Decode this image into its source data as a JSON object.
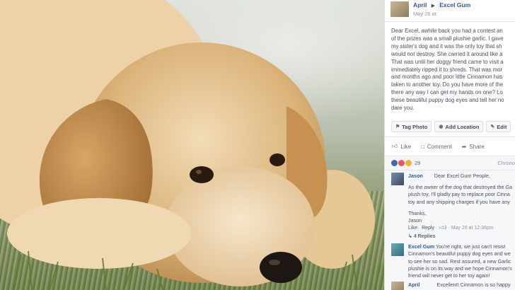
{
  "post": {
    "author": "April",
    "target": "Excel Gum",
    "date": "May 26 at",
    "body_lines": [
      "Dear Excel, awhile back you had a contest an",
      "of the prizes was a small plushie garlic. I gave",
      "my sister's dog and it was the only toy that sh",
      "would not destroy. She carried it around like a",
      "That was until her doggy friend came to visit a",
      "immediately ripped it to shreds. That was mor",
      "and months ago and poor little Cinnamon has",
      "taken to another toy. Do you have more of the",
      "there any way I can get my hands on one? Lo",
      "these beautiful puppy dog eyes and tell her no",
      "dare you."
    ]
  },
  "tagbar": {
    "tag_photo": "Tag Photo",
    "add_location": "Add Location",
    "edit": "Edit"
  },
  "actions": {
    "like": "Like",
    "comment": "Comment",
    "share": "Share"
  },
  "reactions": {
    "count": "29",
    "sort": "Chrono",
    "colors": [
      "#4267b2",
      "#f25268",
      "#f7b125"
    ]
  },
  "comments": [
    {
      "author": "Jason",
      "lines": [
        "Dear Excel Gum People,",
        "",
        "As the owner of the dog that destroyed the Ga",
        "plush toy, I'll gladly pay to replace poor Cinna",
        "toy and any shipping charges if you have any",
        "",
        "Thanks,",
        "Jason"
      ],
      "meta_like": "Like",
      "meta_reply": "Reply",
      "meta_count": "3",
      "meta_date": "May 26 at 12:36pm",
      "replies": "4 Replies"
    },
    {
      "author": "Excel Gum",
      "lines": [
        "You're right, we just can't resist",
        "Cinnamon's beautiful puppy dog eyes and we",
        "to see her so sad. Rest assured, a new Garlic",
        "plushie is on its way and we hope Cinnamon's",
        "friend will never get to her toy again!"
      ]
    },
    {
      "author": "April",
      "lines": [
        "Excellent! Cinnamon is so happy"
      ]
    }
  ]
}
